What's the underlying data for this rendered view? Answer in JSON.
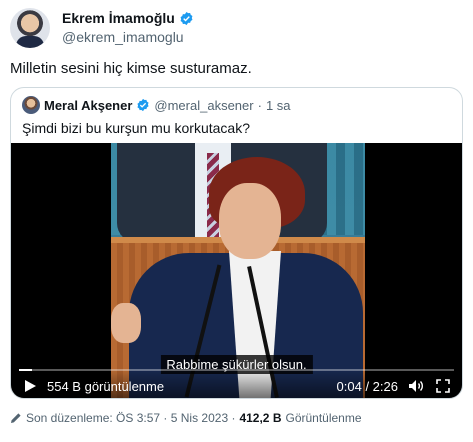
{
  "author": {
    "display_name": "Ekrem İmamoğlu",
    "handle": "@ekrem_imamoglu"
  },
  "tweet": {
    "text": "Milletin sesini hiç kimse susturamaz."
  },
  "quoted": {
    "display_name": "Meral Akşener",
    "handle": "@meral_aksener",
    "separator": "·",
    "time": "1 sa",
    "text": "Şimdi bizi bu kurşun mu korkutacak?"
  },
  "video": {
    "subtitle": "Rabbime şükürler olsun.",
    "views_label": "554 B görüntülenme",
    "time_label": "0:04 / 2:26",
    "progress": 0.03
  },
  "footer": {
    "edited_label": "Son düzenleme: ÖS 3:57 · 5 Nis 2023 ·",
    "views_count": "412,2 B",
    "views_word": "Görüntülenme"
  },
  "colors": {
    "verified_blue": "#1d9bf0",
    "text_primary": "#0f1419",
    "text_secondary": "#536471",
    "border": "#cfd9de"
  },
  "icons": [
    "verified-icon",
    "play-icon",
    "volume-icon",
    "fullscreen-icon",
    "pencil-icon"
  ]
}
